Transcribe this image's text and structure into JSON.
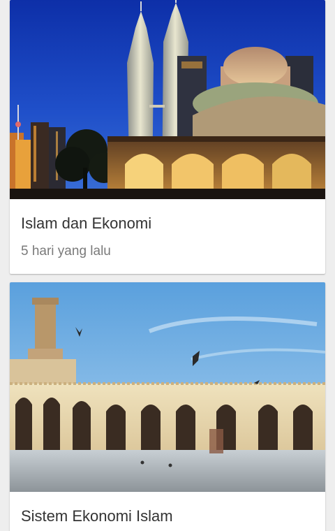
{
  "articles": [
    {
      "title": "Islam dan Ekonomi",
      "time_ago": "5 hari yang lalu"
    },
    {
      "title": "Sistem Ekonomi Islam"
    }
  ]
}
